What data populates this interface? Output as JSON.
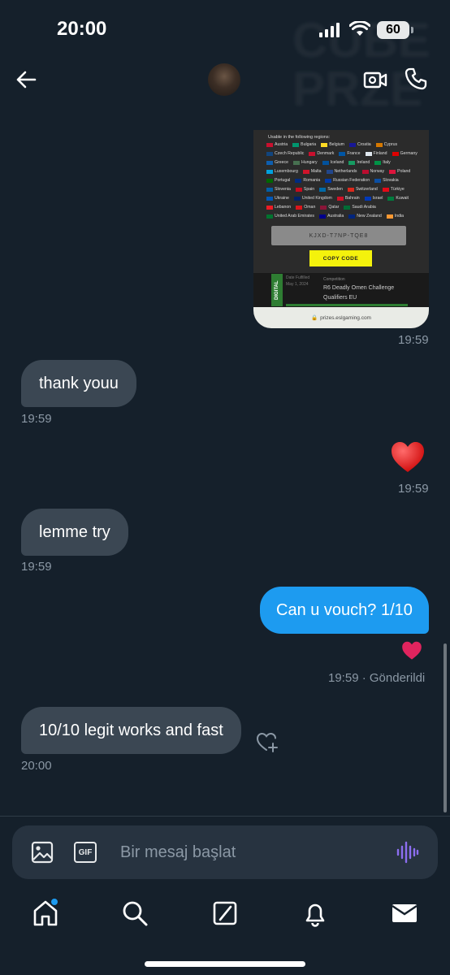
{
  "status_bar": {
    "time": "20:00",
    "battery": "60"
  },
  "header": {
    "back_icon": "arrow-left-icon",
    "video_icon": "video-call-icon",
    "call_icon": "phone-icon"
  },
  "attachment": {
    "regions_title": "Usable in the following regions:",
    "regions": [
      {
        "name": "Austria",
        "c": "#c8102e"
      },
      {
        "name": "Bulgaria",
        "c": "#00966e"
      },
      {
        "name": "Belgium",
        "c": "#fdda24"
      },
      {
        "name": "Croatia",
        "c": "#171796"
      },
      {
        "name": "Cyprus",
        "c": "#d57800"
      },
      {
        "name": "Czech Republic",
        "c": "#11457e"
      },
      {
        "name": "Denmark",
        "c": "#c8102e"
      },
      {
        "name": "France",
        "c": "#0055a4"
      },
      {
        "name": "Finland",
        "c": "#dfe7ef"
      },
      {
        "name": "Germany",
        "c": "#dd0000"
      },
      {
        "name": "Greece",
        "c": "#0d5eaf"
      },
      {
        "name": "Hungary",
        "c": "#477050"
      },
      {
        "name": "Iceland",
        "c": "#02529c"
      },
      {
        "name": "Ireland",
        "c": "#169b62"
      },
      {
        "name": "Italy",
        "c": "#009246"
      },
      {
        "name": "Luxembourg",
        "c": "#00a1de"
      },
      {
        "name": "Malta",
        "c": "#cf142b"
      },
      {
        "name": "Netherlands",
        "c": "#21468b"
      },
      {
        "name": "Norway",
        "c": "#ba0c2f"
      },
      {
        "name": "Poland",
        "c": "#dc143c"
      },
      {
        "name": "Portugal",
        "c": "#006600"
      },
      {
        "name": "Romania",
        "c": "#002b7f"
      },
      {
        "name": "Russian Federation",
        "c": "#0039a6"
      },
      {
        "name": "Slovakia",
        "c": "#0b4ea2"
      },
      {
        "name": "Slovenia",
        "c": "#005da4"
      },
      {
        "name": "Spain",
        "c": "#c60b1e"
      },
      {
        "name": "Sweden",
        "c": "#006aa7"
      },
      {
        "name": "Switzerland",
        "c": "#da291c"
      },
      {
        "name": "Türkiye",
        "c": "#e30a17"
      },
      {
        "name": "Ukraine",
        "c": "#0057b7"
      },
      {
        "name": "United Kingdom",
        "c": "#012169"
      },
      {
        "name": "Bahrain",
        "c": "#ce1126"
      },
      {
        "name": "Israel",
        "c": "#0038b8"
      },
      {
        "name": "Kuwait",
        "c": "#007a3d"
      },
      {
        "name": "Lebanon",
        "c": "#ed1c24"
      },
      {
        "name": "Oman",
        "c": "#db161b"
      },
      {
        "name": "Qatar",
        "c": "#8a1538"
      },
      {
        "name": "Saudi Arabia",
        "c": "#006c35"
      },
      {
        "name": "United Arab Emirates",
        "c": "#00732f"
      },
      {
        "name": "Australia",
        "c": "#00008b"
      },
      {
        "name": "New Zealand",
        "c": "#00247d"
      },
      {
        "name": "India",
        "c": "#ff9933"
      }
    ],
    "code": "KJXD-T7NP-TQE8",
    "copy_label": "COPY CODE",
    "tag": "DIGITAL",
    "date_label": "Date Fulfilled",
    "date_value": "May 1, 2024",
    "competition_label": "Competition",
    "competition_name": "R6 Deadly Omen Challenge Qualifiers EU",
    "url": "prizes.eslgaming.com"
  },
  "messages": {
    "m0_time": "19:59",
    "m1_text": "thank youu",
    "m1_time": "19:59",
    "m2_time": "19:59",
    "m3_text": "lemme try",
    "m3_time": "19:59",
    "m4_text": "Can u vouch? 1/10",
    "m4_time": "19:59",
    "m4_status": "· Gönderildi",
    "m5_text": "10/10 legit works and fast",
    "m5_time": "20:00"
  },
  "composer": {
    "placeholder": "Bir mesaj başlat",
    "gif_label": "GIF"
  },
  "nav": {
    "items": [
      "home-icon",
      "search-icon",
      "grok-icon",
      "notifications-icon",
      "messages-icon"
    ]
  }
}
